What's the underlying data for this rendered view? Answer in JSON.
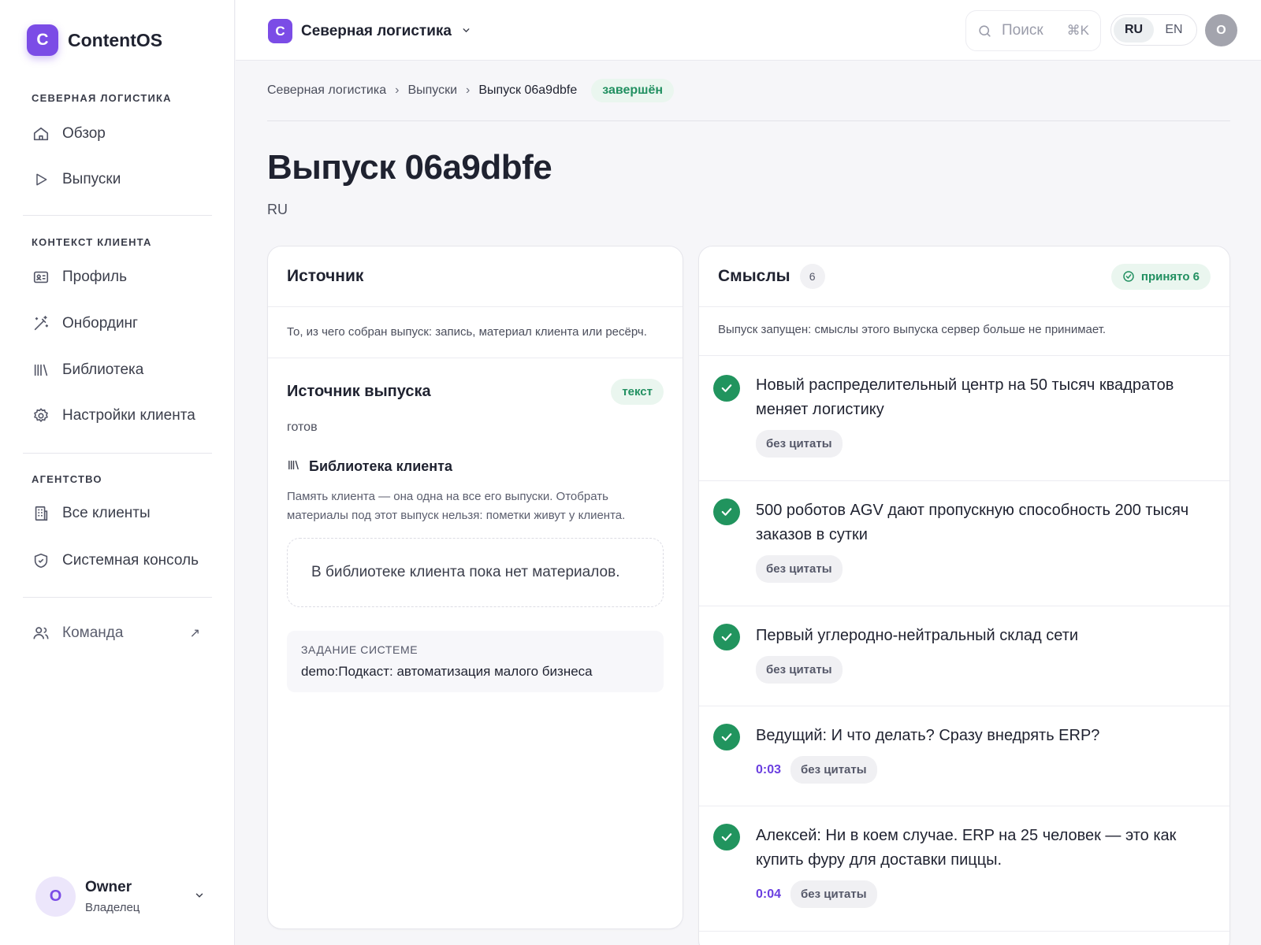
{
  "brand": {
    "logo_letter": "C",
    "name": "ContentOS",
    "accent": "#7b4ce6"
  },
  "sidebar": {
    "section_client": "СЕВЕРНАЯ ЛОГИСТИКА",
    "nav_overview": "Обзор",
    "nav_releases": "Выпуски",
    "section_context": "КОНТЕКСТ КЛИЕНТА",
    "nav_profile": "Профиль",
    "nav_onboarding": "Онбординг",
    "nav_library": "Библиотека",
    "nav_client_settings": "Настройки клиента",
    "section_agency": "АГЕНТСТВО",
    "nav_all_clients": "Все клиенты",
    "nav_system_console": "Системная консоль",
    "nav_team": "Команда",
    "owner_initial": "O",
    "owner_name": "Owner",
    "owner_role": "Владелец"
  },
  "topbar": {
    "org_letter": "C",
    "org_name": "Северная логистика",
    "search_placeholder": "Поиск",
    "search_shortcut": "⌘K",
    "lang_ru": "RU",
    "lang_en": "EN",
    "lang_selected": "RU",
    "user_initial": "O"
  },
  "breadcrumb": {
    "item1": "Северная логистика",
    "item2": "Выпуски",
    "current": "Выпуск 06a9dbfe",
    "status": "завершён"
  },
  "page": {
    "title": "Выпуск 06a9dbfe",
    "language": "RU"
  },
  "source": {
    "title": "Источник",
    "description": "То, из чего собран выпуск: запись, материал клиента или ресёрч.",
    "release_source_title": "Источник выпуска",
    "release_source_tag": "текст",
    "release_source_status": "готов",
    "library_title": "Библиотека клиента",
    "library_description": "Память клиента — она одна на все его выпуски. Отобрать материалы под этот выпуск нельзя: пометки живут у клиента.",
    "library_empty": "В библиотеке клиента пока нет материалов.",
    "task_label": "ЗАДАНИЕ СИСТЕМЕ",
    "task_text": "demo:Подкаст: автоматизация малого бизнеса"
  },
  "meanings": {
    "title": "Смыслы",
    "count": "6",
    "accepted_label": "принято 6",
    "note": "Выпуск запущен: смыслы этого выпуска сервер больше не принимает.",
    "items": [
      {
        "text": "Новый распределительный центр на 50 тысяч квадратов меняет логистику",
        "time": "",
        "chip": "без цитаты"
      },
      {
        "text": "500 роботов AGV дают пропускную способность 200 тысяч заказов в сутки",
        "time": "",
        "chip": "без цитаты"
      },
      {
        "text": "Первый углеродно-нейтральный склад сети",
        "time": "",
        "chip": "без цитаты"
      },
      {
        "text": "Ведущий: И что делать? Сразу внедрять ERP?",
        "time": "0:03",
        "chip": "без цитаты"
      },
      {
        "text": "Алексей: Ни в коем случае. ERP на 25 человек — это как купить фуру для доставки пиццы.",
        "time": "0:04",
        "chip": "без цитаты"
      }
    ]
  }
}
